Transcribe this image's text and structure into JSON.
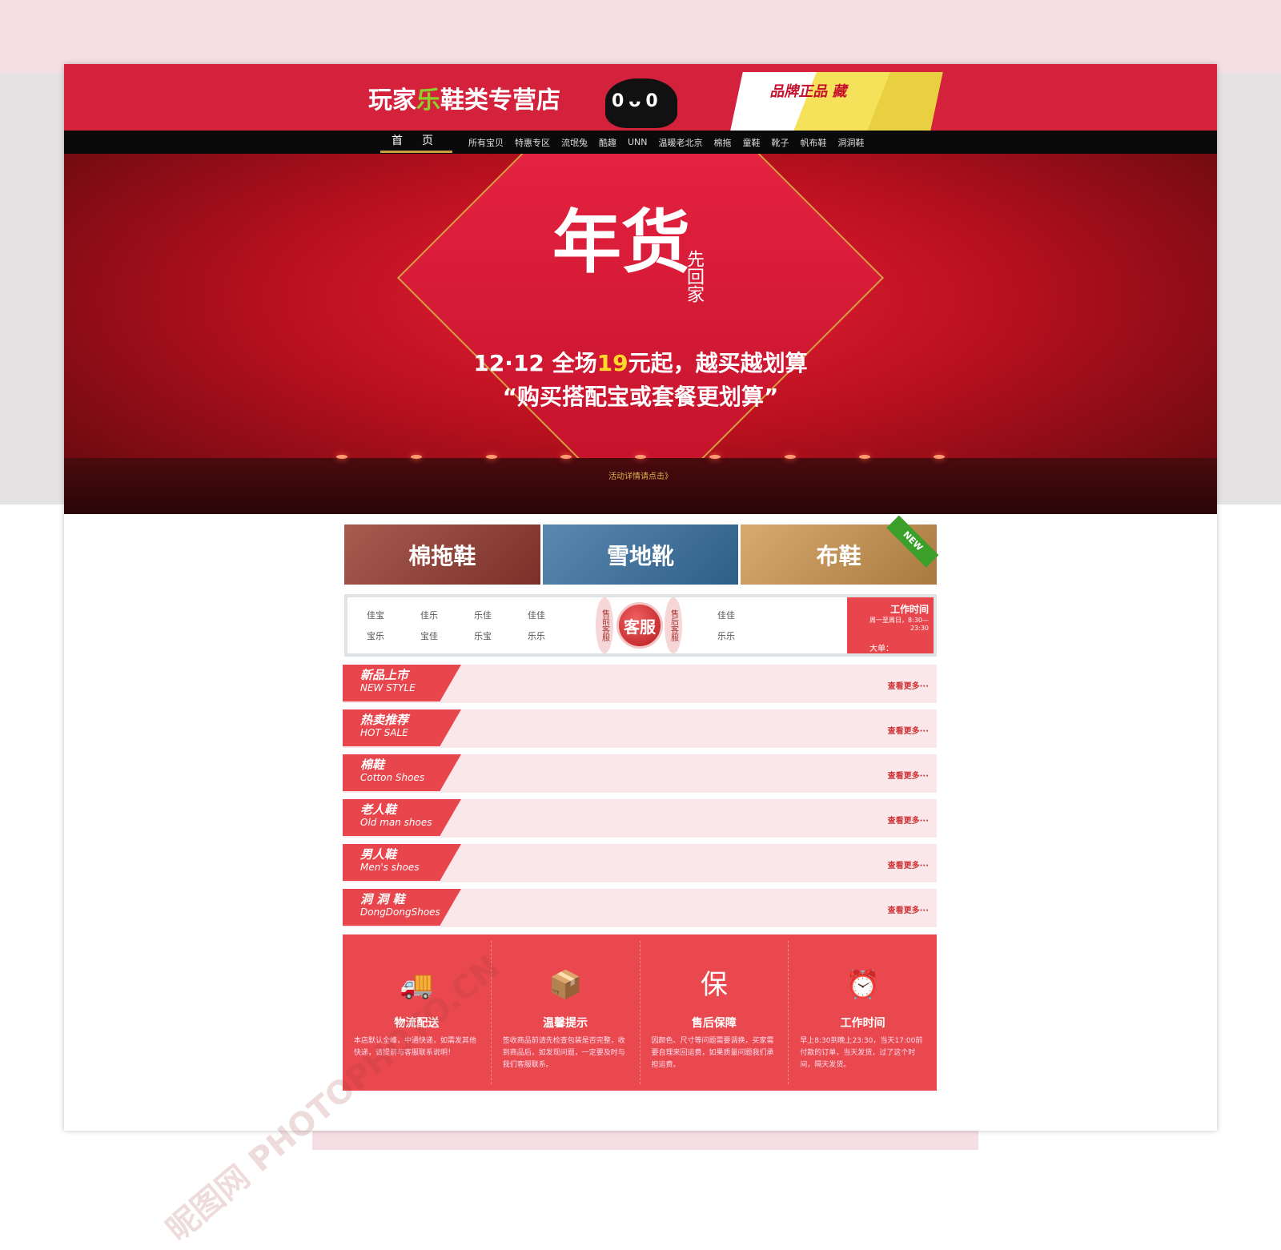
{
  "store": {
    "name_prefix": "玩家",
    "name_le": "乐",
    "name_suffix": "鞋类专营店",
    "mascot": "0ᴗ0",
    "promo": "品牌正品 藏"
  },
  "nav": {
    "home": "首页",
    "items": [
      "所有宝贝",
      "特惠专区",
      "流氓兔",
      "酷趣",
      "UNN",
      "温暖老北京",
      "棉拖",
      "童鞋",
      "靴子",
      "帆布鞋",
      "洞洞鞋"
    ]
  },
  "banner": {
    "title": "年货",
    "subtitle": "先回家",
    "line1_pre": "12·12 全场",
    "line1_hl": "19",
    "line1_post": "元起，越买越划算",
    "line2": "“购买搭配宝或套餐更划算”",
    "link": "活动详情请点击》"
  },
  "categories": [
    {
      "label": "棉拖鞋"
    },
    {
      "label": "雪地靴"
    },
    {
      "label": "布鞋",
      "badge": "NEW"
    }
  ],
  "service": {
    "pre_names": [
      "佳宝",
      "佳乐",
      "乐佳",
      "佳佳",
      "宝乐",
      "宝佳",
      "乐宝",
      "乐乐"
    ],
    "pre_label": "售前客服",
    "center": "客服",
    "post_label": "售后客服",
    "post_names": [
      "佳佳",
      "乐乐"
    ],
    "hours_title": "工作时间",
    "hours_text": "周一至周日，8:30—23:30",
    "bulk": "大单："
  },
  "sections": [
    {
      "cn": "新品上市",
      "en": "NEW STYLE",
      "more": "查看更多···"
    },
    {
      "cn": "热卖推荐",
      "en": "HOT SALE",
      "more": "查看更多···"
    },
    {
      "cn": "棉鞋",
      "en": "Cotton Shoes",
      "more": "查看更多···"
    },
    {
      "cn": "老人鞋",
      "en": "Old man shoes",
      "more": "查看更多···"
    },
    {
      "cn": "男人鞋",
      "en": "Men's shoes",
      "more": "查看更多···"
    },
    {
      "cn": "洞 洞 鞋",
      "en": "DongDongShoes",
      "more": "查看更多···"
    }
  ],
  "footer": [
    {
      "icon": "truck-icon",
      "glyph": "🚚",
      "title": "物流配送",
      "desc": "本店默认全峰，中通快递，如需发其他快递，请提前与客服联系说明！"
    },
    {
      "icon": "box-icon",
      "glyph": "📦",
      "title": "温馨提示",
      "desc": "签收商品前请先检查包装是否完整，收到商品后，如发现问题，一定要及时与我们客服联系。"
    },
    {
      "icon": "shield-icon",
      "glyph": "保",
      "title": "售后保障",
      "desc": "因颜色、尺寸等问题需要调换，买家需要自理来回运费，如果质量问题我们承担运费。"
    },
    {
      "icon": "alarm-clock-icon",
      "glyph": "⏰",
      "title": "工作时间",
      "desc": "早上8:30到晚上23:30，当天17:00前付款的订单，当天发货，过了这个时间，隔天发货。"
    }
  ],
  "watermark": "昵图网 PHOTOPHOTO.CN"
}
